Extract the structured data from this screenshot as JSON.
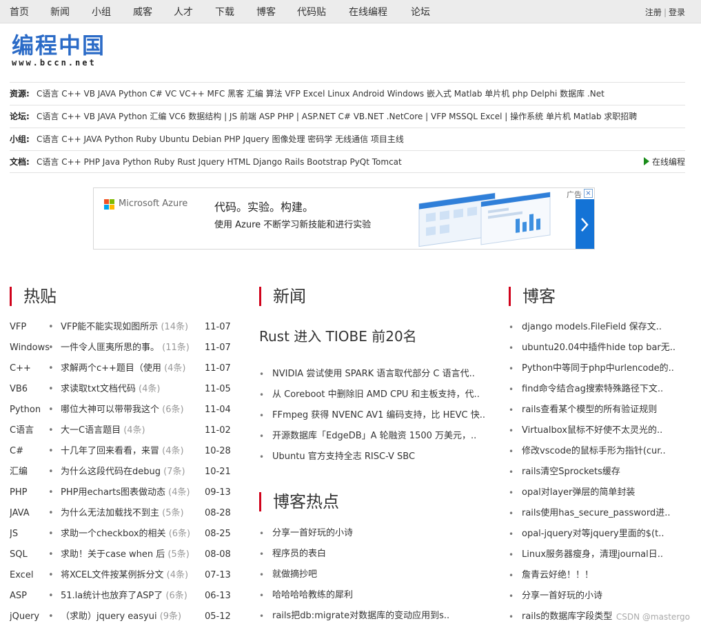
{
  "topnav": {
    "items": [
      "首页",
      "新闻",
      "小组",
      "威客",
      "人才",
      "下载",
      "博客",
      "代码贴",
      "在线编程",
      "论坛"
    ],
    "register": "注册",
    "login": "登录"
  },
  "logo": {
    "cn": "编程中国",
    "url": "www.bccn.net"
  },
  "categories": [
    {
      "label": "资源:",
      "items": "C语言 C++ VB JAVA Python C# VC VC++ MFC 黑客 汇编 算法 VFP Excel Linux Android Windows 嵌入式 Matlab 单片机 php Delphi 数据库 .Net"
    },
    {
      "label": "论坛:",
      "items": "C语言 C++ VB JAVA Python 汇编 VC6 数据结构 | JS 前端 ASP PHP | ASP.NET C# VB.NET .NetCore | VFP MSSQL Excel | 操作系统 单片机 Matlab 求职招聘"
    },
    {
      "label": "小组:",
      "items": "C语言 C++ JAVA Python Ruby Ubuntu Debian PHP Jquery 图像处理 密码学 无线通信 项目主线"
    },
    {
      "label": "文档:",
      "items": "C语言  C++  PHP  Java  Python  Ruby  Rust  Jquery  HTML  Django  Rails  Bootstrap  PyQt  Tomcat"
    }
  ],
  "online_link": "在线编程",
  "ad": {
    "brand": "Microsoft Azure",
    "headline": "代码。实验。构建。",
    "subline": "使用 Azure 不断学习新技能和进行实验",
    "tag": "广告",
    "close": "×",
    "colors": {
      "red": "#f25022",
      "green": "#7fba00",
      "blue": "#00a4ef",
      "yellow": "#ffb900",
      "arrow_bg": "#1473d6"
    }
  },
  "sections": {
    "hot": "热贴",
    "news": "新闻",
    "blog": "博客",
    "blog_hot": "博客热点"
  },
  "hot": [
    {
      "tag": "VFP",
      "title": "VFP能不能实现如图所示",
      "count": "(14条)",
      "date": "11-07"
    },
    {
      "tag": "Windows",
      "title": "一件令人匪夷所思的事。",
      "count": "(11条)",
      "date": "11-07"
    },
    {
      "tag": "C++",
      "title": "求解两个c++题目（使用",
      "count": "(4条)",
      "date": "11-07"
    },
    {
      "tag": "VB6",
      "title": "求读取txt文档代码",
      "count": "(4条)",
      "date": "11-05"
    },
    {
      "tag": "Python",
      "title": "哪位大神可以带带我这个",
      "count": "(6条)",
      "date": "11-04"
    },
    {
      "tag": "C语言",
      "title": "大一C语言题目",
      "count": "(4条)",
      "date": "11-02"
    },
    {
      "tag": "C#",
      "title": "十几年了回来看看，来冒",
      "count": "(4条)",
      "date": "10-28"
    },
    {
      "tag": "汇编",
      "title": "为什么这段代码在debug",
      "count": "(7条)",
      "date": "10-21"
    },
    {
      "tag": "PHP",
      "title": "PHP用echarts图表做动态",
      "count": "(4条)",
      "date": "09-13"
    },
    {
      "tag": "JAVA",
      "title": "为什么无法加载找不到主",
      "count": "(5条)",
      "date": "08-28"
    },
    {
      "tag": "JS",
      "title": "求助一个checkbox的相关",
      "count": "(6条)",
      "date": "08-25"
    },
    {
      "tag": "SQL",
      "title": "求助！关于case when 后",
      "count": "(5条)",
      "date": "08-08"
    },
    {
      "tag": "Excel",
      "title": "将XCEL文件按某例拆分文",
      "count": "(4条)",
      "date": "07-13"
    },
    {
      "tag": "ASP",
      "title": "51.la统计也放弃了ASP了",
      "count": "(6条)",
      "date": "06-13"
    },
    {
      "tag": "jQuery",
      "title": "（求助）jquery easyui",
      "count": "(9条)",
      "date": "05-12"
    }
  ],
  "news": {
    "headline": "Rust 进入 TIOBE 前20名",
    "items": [
      "NVIDIA 尝试使用 SPARK 语言取代部分 C 语言代..",
      "从 Coreboot 中删除旧 AMD CPU 和主板支持，代..",
      "FFmpeg 获得 NVENC AV1 编码支持，比 HEVC 快..",
      "开源数据库「EdgeDB」A 轮融资 1500 万美元，..",
      "Ubuntu 官方支持全志 RISC-V SBC"
    ]
  },
  "blog_hot": [
    "分享一首好玩的小诗",
    "程序员的表白",
    "就做摘抄吧",
    "哈哈哈哈教练的犀利",
    "rails把db:migrate对数据库的变动应用到s.."
  ],
  "blog": [
    "django models.FileField 保存文..",
    "ubuntu20.04中插件hide top bar无..",
    "Python中等同于php中urlencode的..",
    "find命令结合ag搜索特殊路径下文..",
    "rails查看某个模型的所有验证规则",
    "Virtualbox鼠标不好使不太灵光的..",
    "修改vscode的鼠标手形为指针(cur..",
    "rails清空Sprockets缓存",
    "opal对layer弹层的简单封装",
    "rails使用has_secure_password进..",
    "opal-jquery对等jquery里面的$(t..",
    "Linux服务器瘦身，清理journal日..",
    "詹青云好绝！！！",
    "分享一首好玩的小诗",
    "rails的数据库字段类型"
  ],
  "watermark": "CSDN @mastergo"
}
